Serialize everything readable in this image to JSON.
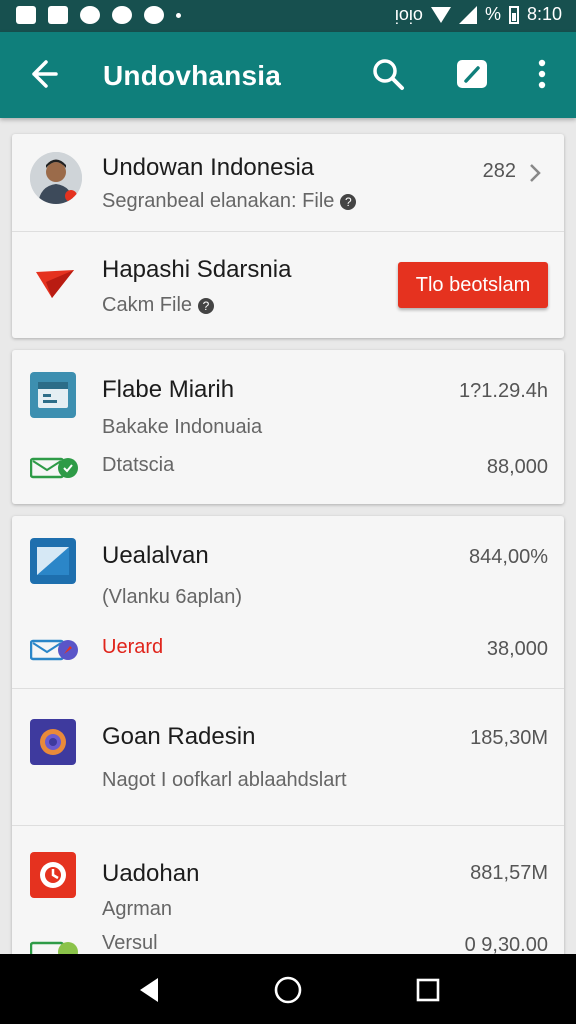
{
  "status_bar": {
    "time": "8:10",
    "carrier": "ᴉᴏᴉᴏ",
    "battery_text": "%"
  },
  "app_bar": {
    "title": "Undovhansia",
    "icons": [
      "back-arrow-icon",
      "search-icon",
      "compose-icon",
      "more-vert-icon"
    ]
  },
  "rows": [
    {
      "title": "Undowan Indonesia",
      "subtitle": "Segranbeal elanakan: File",
      "value": "282"
    },
    {
      "title": "Hapashi Sdarsnia",
      "subtitle": "Cakm File",
      "button": "Tlo beotslam"
    },
    {
      "title": "Flabe Miarih",
      "subtitle": "Bakake Indonuaia",
      "meta": "Dtatscia",
      "value": "1?1.29.4h",
      "meta_value": "88,000"
    },
    {
      "title": "Uealalvan",
      "subtitle": "(Vlanku 6aplan)",
      "meta": "Uerard",
      "value": "844,00%",
      "meta_value": "38,000"
    },
    {
      "title": "Goan Radesin",
      "subtitle": "Nagot I oofkarl ablaahdslart",
      "value": "185,30M"
    },
    {
      "title": "Uadohan",
      "subtitle": "Agrman",
      "meta": "Versul",
      "value": "881,57M",
      "meta_value": "0 9,30.00"
    }
  ],
  "colors": {
    "status_bar": "#17504f",
    "app_bar": "#0f7f7b",
    "accent_red": "#e5321f",
    "background": "#e9e9e9"
  }
}
